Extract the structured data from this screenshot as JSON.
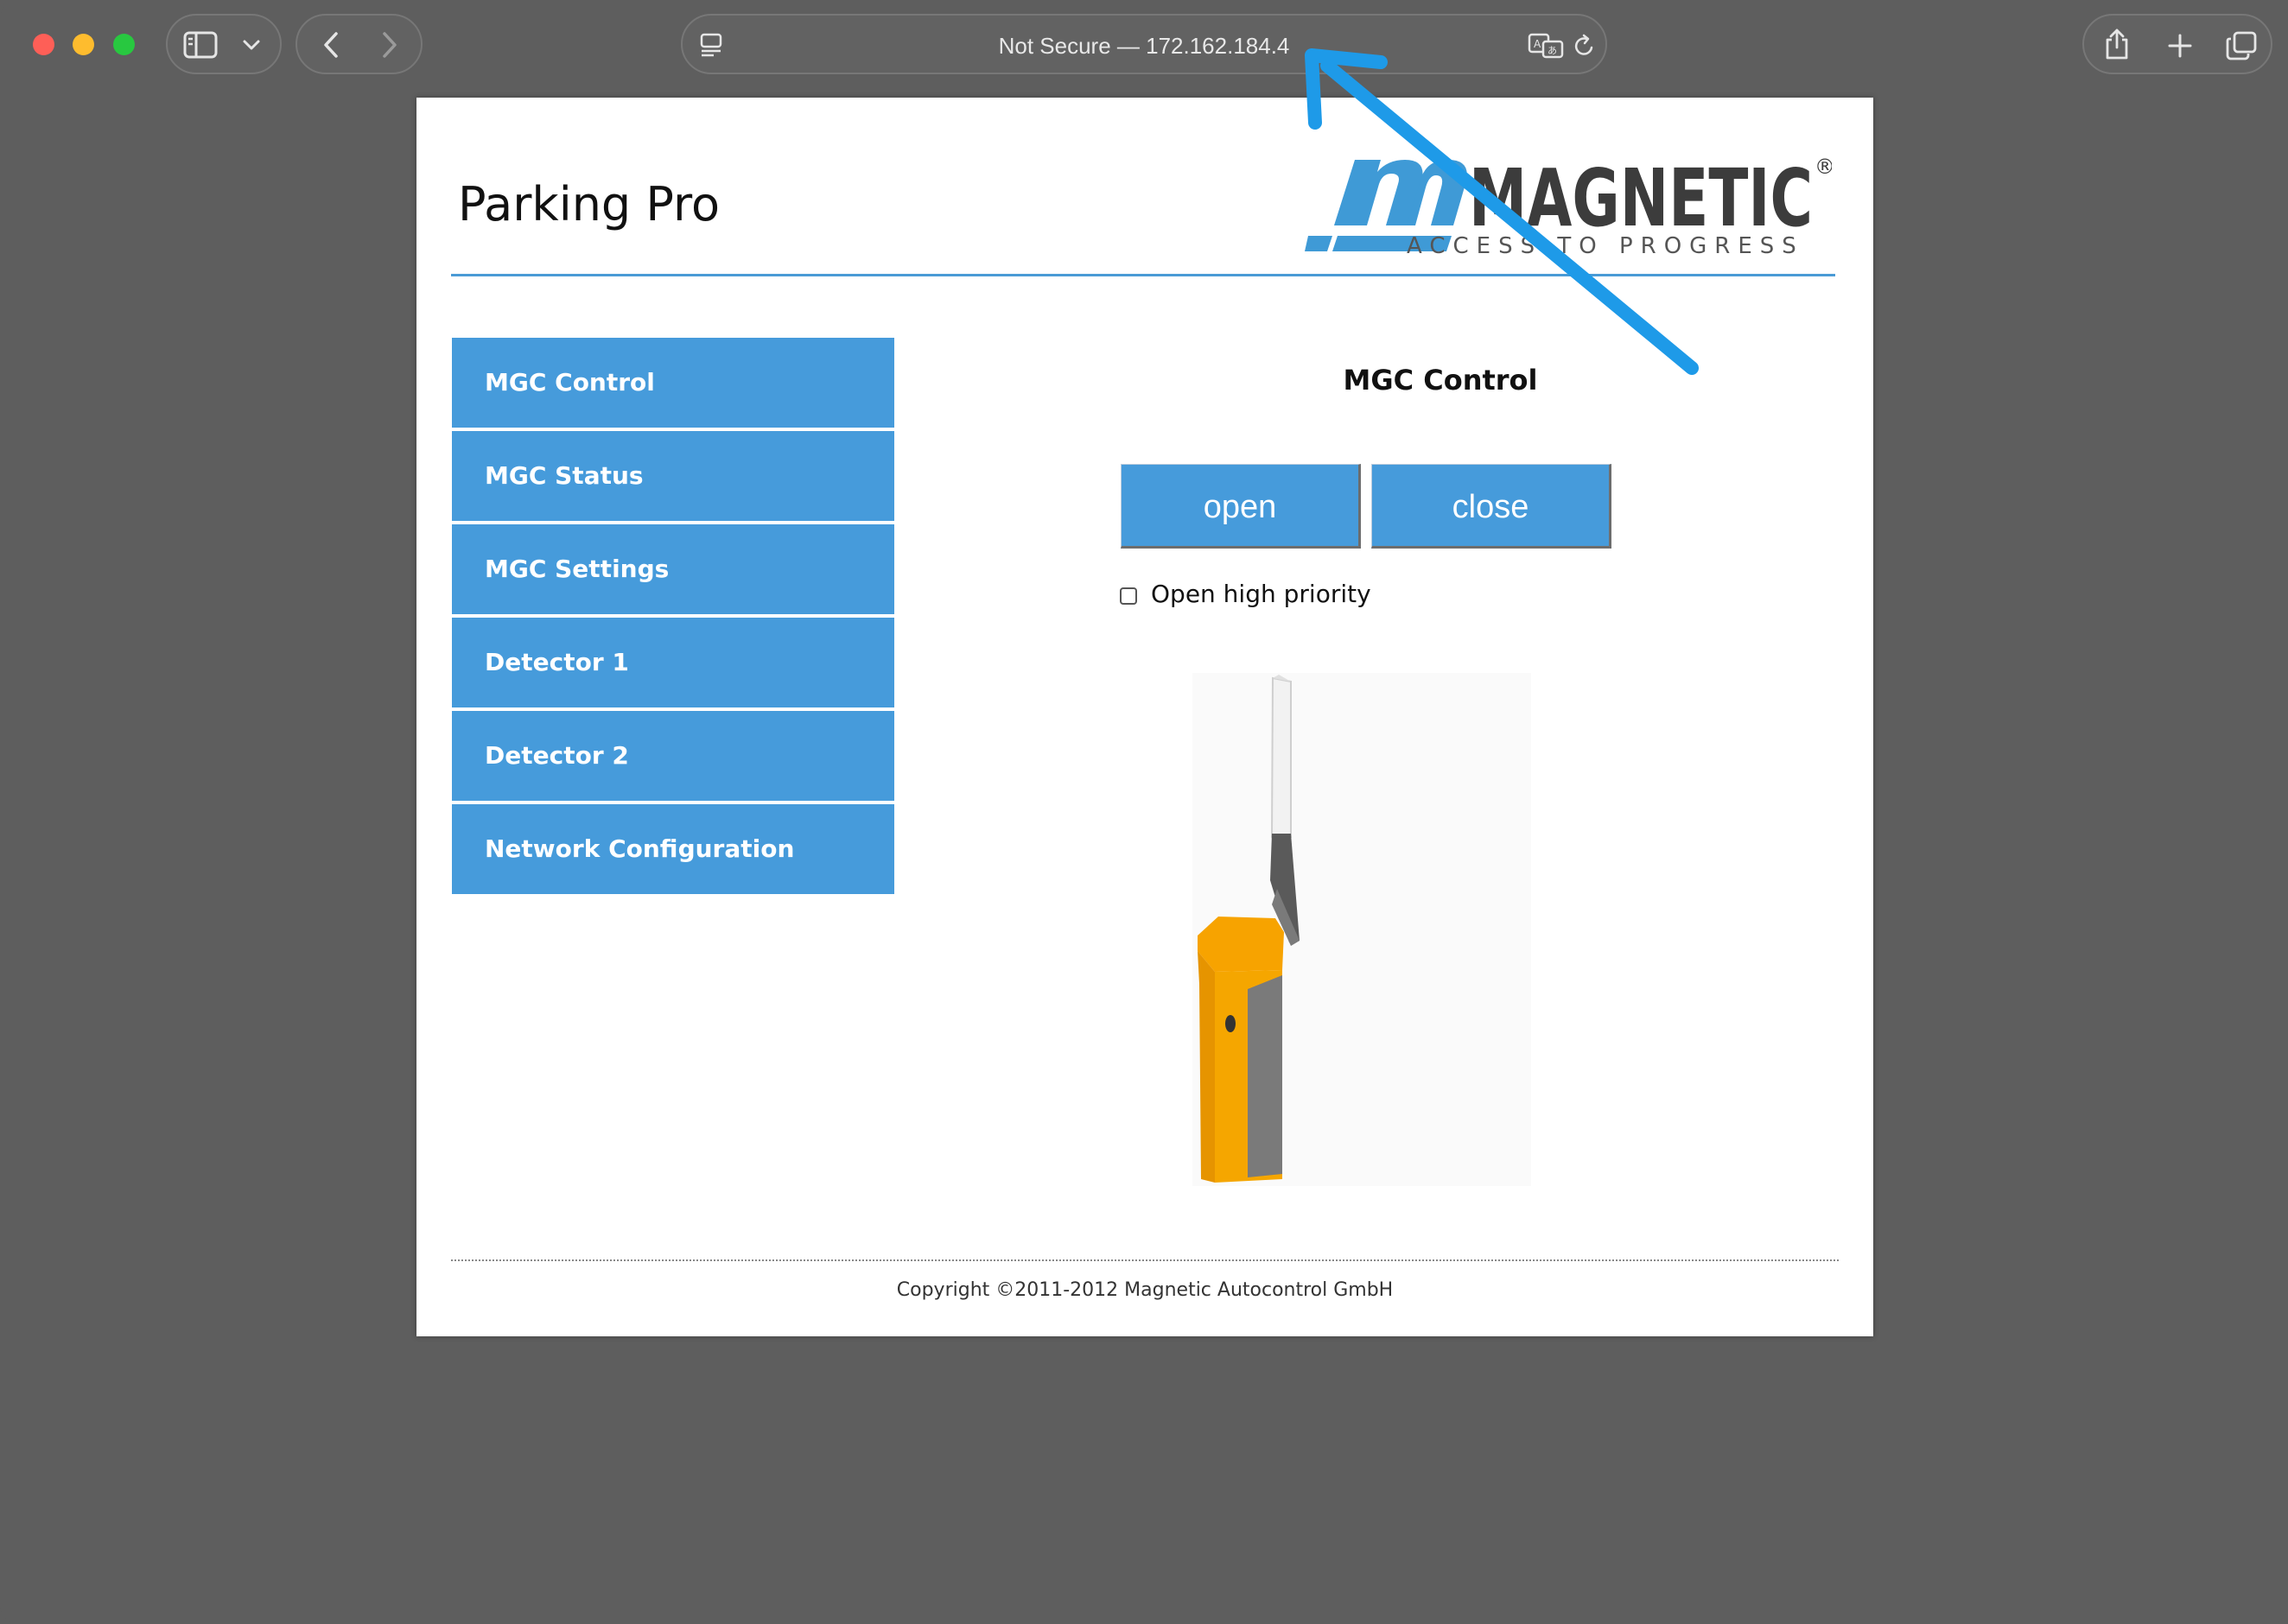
{
  "browser": {
    "url_bar_text": "Not Secure — 172.162.184.4",
    "icons": [
      "sidebar-icon",
      "chevron-down-icon",
      "back-icon",
      "forward-icon",
      "page-menu-icon",
      "translate-icon",
      "reload-icon",
      "share-icon",
      "new-tab-icon",
      "tab-overview-icon"
    ]
  },
  "page": {
    "title": "Parking Pro",
    "logo": {
      "brand": "MAGNETIC",
      "tagline": "ACCESS TO PROGRESS",
      "registered": "®"
    },
    "menu": [
      {
        "label": "MGC Control"
      },
      {
        "label": "MGC Status"
      },
      {
        "label": "MGC Settings"
      },
      {
        "label": "Detector 1"
      },
      {
        "label": "Detector 2"
      },
      {
        "label": "Network Configuration"
      }
    ],
    "section_title": "MGC Control",
    "buttons": {
      "open": "open",
      "close": "close"
    },
    "checkbox": {
      "label": "Open high priority",
      "checked": false
    },
    "footer": "Copyright ©2011-2012 Magnetic Autocontrol GmbH"
  },
  "colors": {
    "accent": "#469bdb",
    "annotation_arrow": "#1e9ae8",
    "barrier_housing": "#f5a100"
  }
}
